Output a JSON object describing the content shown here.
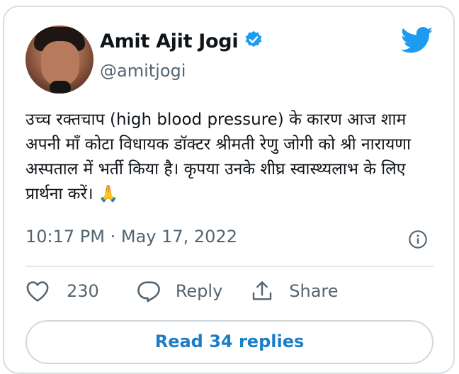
{
  "author": {
    "name": "Amit Ajit Jogi",
    "handle": "@amitjogi",
    "verified": true
  },
  "tweet": {
    "text": "उच्च रक्तचाप (high blood pressure) के कारण आज शाम अपनी माँ कोटा विधायक डॉक्टर श्रीमती रेणु जोगी को श्री नारायणा अस्पताल में भर्ती किया है। कृपया उनके शीघ्र स्वास्थ्यलाभ के लिए प्रार्थना करें। 🙏",
    "timestamp": "10:17 PM · May 17, 2022"
  },
  "actions": {
    "likes": "230",
    "reply_label": "Reply",
    "share_label": "Share"
  },
  "read_replies_label": "Read 34 replies",
  "colors": {
    "twitter_blue": "#1d9bf0",
    "link_blue": "#1d7ec6",
    "muted": "#536471"
  },
  "icons": [
    "verified-badge-icon",
    "twitter-bird-icon",
    "info-icon",
    "heart-icon",
    "reply-icon",
    "share-icon"
  ]
}
